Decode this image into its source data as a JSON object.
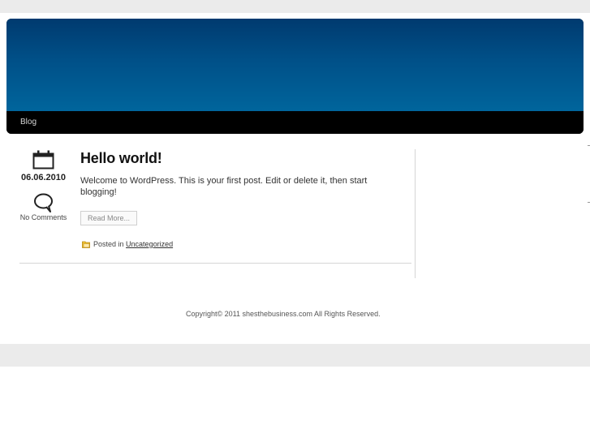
{
  "nav": {
    "items": [
      {
        "label": "Blog"
      }
    ]
  },
  "post": {
    "date": "06.06.2010",
    "comments_label": "No Comments",
    "title": "Hello world!",
    "excerpt": "Welcome to WordPress. This is your first post. Edit or delete it, then start blogging!",
    "read_more_label": "Read More...",
    "posted_in_prefix": "Posted in",
    "category": "Uncategorized"
  },
  "footer": {
    "copyright": "Copyright© 2011 shesthebusiness.com All Rights Reserved."
  },
  "icons": {
    "date": "calendar-icon",
    "comments": "speech-bubble-icon",
    "category": "folder-icon"
  },
  "colors": {
    "header_top": "#003a6f",
    "header_bottom": "#00659c",
    "nav_bar": "#000000",
    "page_band": "#ebebeb"
  }
}
